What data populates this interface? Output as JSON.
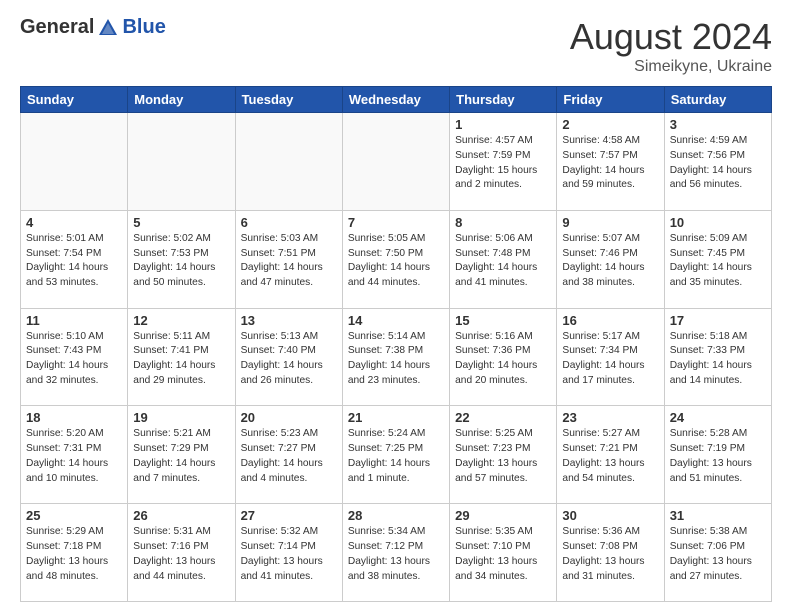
{
  "header": {
    "logo_general": "General",
    "logo_blue": "Blue",
    "month_year": "August 2024",
    "location": "Simeikyne, Ukraine"
  },
  "days_of_week": [
    "Sunday",
    "Monday",
    "Tuesday",
    "Wednesday",
    "Thursday",
    "Friday",
    "Saturday"
  ],
  "weeks": [
    [
      {
        "day": "",
        "info": ""
      },
      {
        "day": "",
        "info": ""
      },
      {
        "day": "",
        "info": ""
      },
      {
        "day": "",
        "info": ""
      },
      {
        "day": "1",
        "info": "Sunrise: 4:57 AM\nSunset: 7:59 PM\nDaylight: 15 hours\nand 2 minutes."
      },
      {
        "day": "2",
        "info": "Sunrise: 4:58 AM\nSunset: 7:57 PM\nDaylight: 14 hours\nand 59 minutes."
      },
      {
        "day": "3",
        "info": "Sunrise: 4:59 AM\nSunset: 7:56 PM\nDaylight: 14 hours\nand 56 minutes."
      }
    ],
    [
      {
        "day": "4",
        "info": "Sunrise: 5:01 AM\nSunset: 7:54 PM\nDaylight: 14 hours\nand 53 minutes."
      },
      {
        "day": "5",
        "info": "Sunrise: 5:02 AM\nSunset: 7:53 PM\nDaylight: 14 hours\nand 50 minutes."
      },
      {
        "day": "6",
        "info": "Sunrise: 5:03 AM\nSunset: 7:51 PM\nDaylight: 14 hours\nand 47 minutes."
      },
      {
        "day": "7",
        "info": "Sunrise: 5:05 AM\nSunset: 7:50 PM\nDaylight: 14 hours\nand 44 minutes."
      },
      {
        "day": "8",
        "info": "Sunrise: 5:06 AM\nSunset: 7:48 PM\nDaylight: 14 hours\nand 41 minutes."
      },
      {
        "day": "9",
        "info": "Sunrise: 5:07 AM\nSunset: 7:46 PM\nDaylight: 14 hours\nand 38 minutes."
      },
      {
        "day": "10",
        "info": "Sunrise: 5:09 AM\nSunset: 7:45 PM\nDaylight: 14 hours\nand 35 minutes."
      }
    ],
    [
      {
        "day": "11",
        "info": "Sunrise: 5:10 AM\nSunset: 7:43 PM\nDaylight: 14 hours\nand 32 minutes."
      },
      {
        "day": "12",
        "info": "Sunrise: 5:11 AM\nSunset: 7:41 PM\nDaylight: 14 hours\nand 29 minutes."
      },
      {
        "day": "13",
        "info": "Sunrise: 5:13 AM\nSunset: 7:40 PM\nDaylight: 14 hours\nand 26 minutes."
      },
      {
        "day": "14",
        "info": "Sunrise: 5:14 AM\nSunset: 7:38 PM\nDaylight: 14 hours\nand 23 minutes."
      },
      {
        "day": "15",
        "info": "Sunrise: 5:16 AM\nSunset: 7:36 PM\nDaylight: 14 hours\nand 20 minutes."
      },
      {
        "day": "16",
        "info": "Sunrise: 5:17 AM\nSunset: 7:34 PM\nDaylight: 14 hours\nand 17 minutes."
      },
      {
        "day": "17",
        "info": "Sunrise: 5:18 AM\nSunset: 7:33 PM\nDaylight: 14 hours\nand 14 minutes."
      }
    ],
    [
      {
        "day": "18",
        "info": "Sunrise: 5:20 AM\nSunset: 7:31 PM\nDaylight: 14 hours\nand 10 minutes."
      },
      {
        "day": "19",
        "info": "Sunrise: 5:21 AM\nSunset: 7:29 PM\nDaylight: 14 hours\nand 7 minutes."
      },
      {
        "day": "20",
        "info": "Sunrise: 5:23 AM\nSunset: 7:27 PM\nDaylight: 14 hours\nand 4 minutes."
      },
      {
        "day": "21",
        "info": "Sunrise: 5:24 AM\nSunset: 7:25 PM\nDaylight: 14 hours\nand 1 minute."
      },
      {
        "day": "22",
        "info": "Sunrise: 5:25 AM\nSunset: 7:23 PM\nDaylight: 13 hours\nand 57 minutes."
      },
      {
        "day": "23",
        "info": "Sunrise: 5:27 AM\nSunset: 7:21 PM\nDaylight: 13 hours\nand 54 minutes."
      },
      {
        "day": "24",
        "info": "Sunrise: 5:28 AM\nSunset: 7:19 PM\nDaylight: 13 hours\nand 51 minutes."
      }
    ],
    [
      {
        "day": "25",
        "info": "Sunrise: 5:29 AM\nSunset: 7:18 PM\nDaylight: 13 hours\nand 48 minutes."
      },
      {
        "day": "26",
        "info": "Sunrise: 5:31 AM\nSunset: 7:16 PM\nDaylight: 13 hours\nand 44 minutes."
      },
      {
        "day": "27",
        "info": "Sunrise: 5:32 AM\nSunset: 7:14 PM\nDaylight: 13 hours\nand 41 minutes."
      },
      {
        "day": "28",
        "info": "Sunrise: 5:34 AM\nSunset: 7:12 PM\nDaylight: 13 hours\nand 38 minutes."
      },
      {
        "day": "29",
        "info": "Sunrise: 5:35 AM\nSunset: 7:10 PM\nDaylight: 13 hours\nand 34 minutes."
      },
      {
        "day": "30",
        "info": "Sunrise: 5:36 AM\nSunset: 7:08 PM\nDaylight: 13 hours\nand 31 minutes."
      },
      {
        "day": "31",
        "info": "Sunrise: 5:38 AM\nSunset: 7:06 PM\nDaylight: 13 hours\nand 27 minutes."
      }
    ]
  ]
}
